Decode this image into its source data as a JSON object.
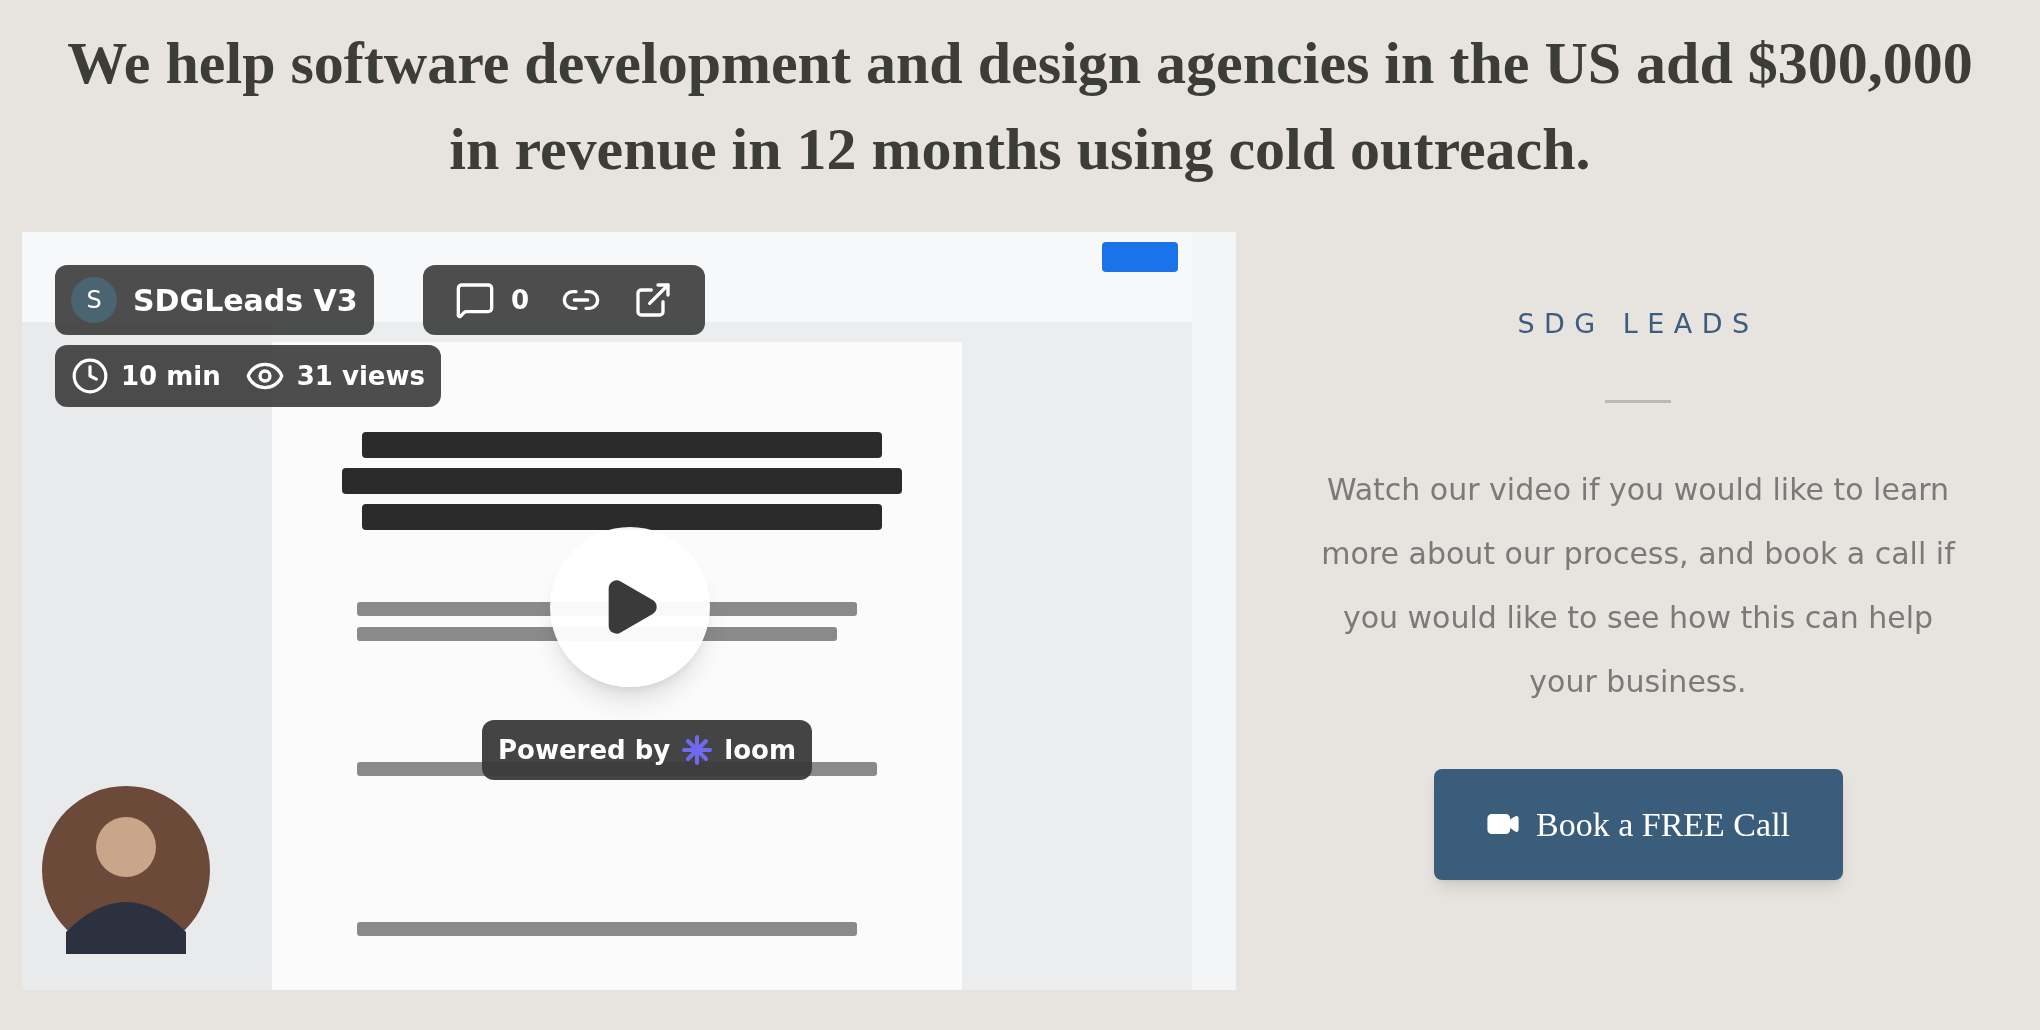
{
  "heading": "We help software development and design agencies in the US add $300,000 in revenue in 12 months using cold outreach.",
  "video": {
    "title": "SDGLeads V3",
    "avatar": "S",
    "comments": "0",
    "duration": "10 min",
    "views": "31 views",
    "powered_by": "Powered by",
    "brand": "loom"
  },
  "aside": {
    "brand": "SDG LEADS",
    "text": "Watch our video if you would like to learn more about our process, and book a call if you would like to see how this can help your business.",
    "button": "Book a FREE Call"
  }
}
